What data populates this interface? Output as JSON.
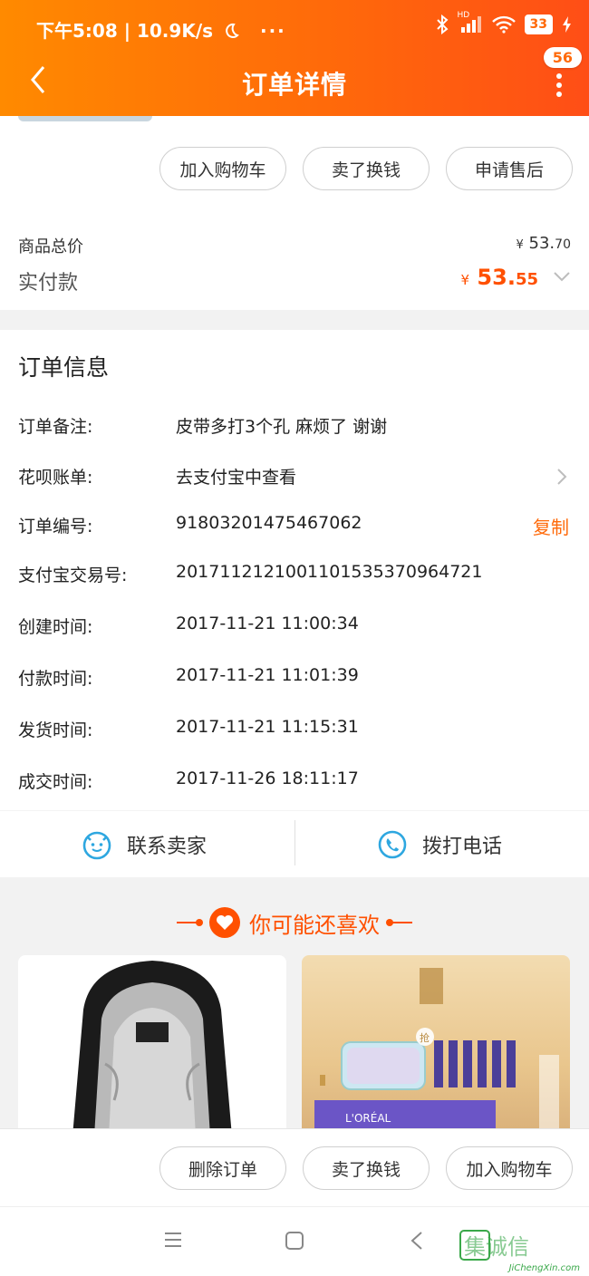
{
  "status_bar": {
    "left_text": "下午5:08 | 10.9K/s",
    "dots": "···",
    "hd": "HD",
    "battery": "33"
  },
  "header": {
    "title": "订单详情",
    "badge_count": "56"
  },
  "top_actions": [
    "加入购物车",
    "卖了换钱",
    "申请售后"
  ],
  "price": {
    "total_label": "商品总价",
    "total_currency": "¥",
    "total_int": "53.",
    "total_dec": "70",
    "paid_label": "实付款",
    "paid_currency": "¥",
    "paid_int": "53.",
    "paid_dec": "55"
  },
  "order_info": {
    "title": "订单信息",
    "rows": [
      {
        "key": "订单备注:",
        "value": "皮带多打3个孔 麻烦了 谢谢"
      },
      {
        "key": "花呗账单:",
        "value": "去支付宝中查看"
      },
      {
        "key": "订单编号:",
        "value": "91803201475467062"
      },
      {
        "key": "支付宝交易号:",
        "value": "2017112121001101535370964721"
      },
      {
        "key": "创建时间:",
        "value": "2017-11-21 11:00:34"
      },
      {
        "key": "付款时间:",
        "value": "2017-11-21 11:01:39"
      },
      {
        "key": "发货时间:",
        "value": "2017-11-21 11:15:31"
      },
      {
        "key": "成交时间:",
        "value": "2017-11-26 18:11:17"
      }
    ],
    "copy_label": "复制"
  },
  "contact": {
    "seller_label": "联系卖家",
    "phone_label": "拨打电话"
  },
  "recommend": {
    "title": "你可能还喜欢",
    "badge_text": "抢",
    "brand_text": "L'ORÉAL"
  },
  "bottom_actions": [
    "删除订单",
    "卖了换钱",
    "加入购物车"
  ],
  "watermark": {
    "text": "集诚信",
    "url": "JiChengXin.com"
  },
  "colors": {
    "accent": "#ff5000",
    "header_start": "#ff8a00",
    "header_end": "#ff4e16"
  }
}
